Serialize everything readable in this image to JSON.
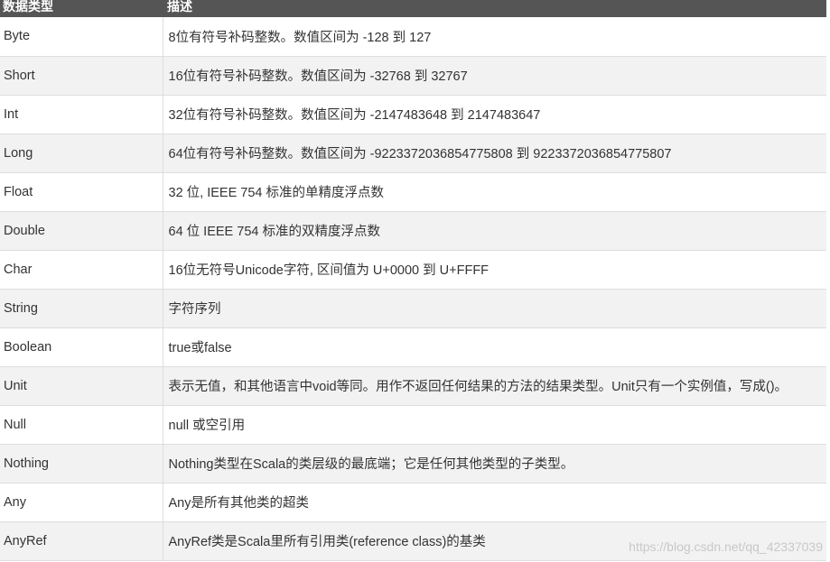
{
  "table": {
    "headers": [
      "数据类型",
      "描述"
    ],
    "rows": [
      {
        "type": "Byte",
        "desc": "8位有符号补码整数。数值区间为 -128 到 127"
      },
      {
        "type": "Short",
        "desc": "16位有符号补码整数。数值区间为 -32768 到 32767"
      },
      {
        "type": "Int",
        "desc": "32位有符号补码整数。数值区间为 -2147483648 到 2147483647"
      },
      {
        "type": "Long",
        "desc": "64位有符号补码整数。数值区间为 -9223372036854775808 到 9223372036854775807"
      },
      {
        "type": "Float",
        "desc": "32 位, IEEE 754 标准的单精度浮点数"
      },
      {
        "type": "Double",
        "desc": "64 位 IEEE 754 标准的双精度浮点数"
      },
      {
        "type": "Char",
        "desc": "16位无符号Unicode字符, 区间值为 U+0000 到 U+FFFF"
      },
      {
        "type": "String",
        "desc": "字符序列"
      },
      {
        "type": "Boolean",
        "desc": "true或false"
      },
      {
        "type": "Unit",
        "desc": "表示无值，和其他语言中void等同。用作不返回任何结果的方法的结果类型。Unit只有一个实例值，写成()。"
      },
      {
        "type": "Null",
        "desc": "null 或空引用"
      },
      {
        "type": "Nothing",
        "desc": "Nothing类型在Scala的类层级的最底端；它是任何其他类型的子类型。"
      },
      {
        "type": "Any",
        "desc": "Any是所有其他类的超类"
      },
      {
        "type": "AnyRef",
        "desc": "AnyRef类是Scala里所有引用类(reference class)的基类"
      }
    ]
  },
  "watermark": "https://blog.csdn.net/qq_42337039"
}
